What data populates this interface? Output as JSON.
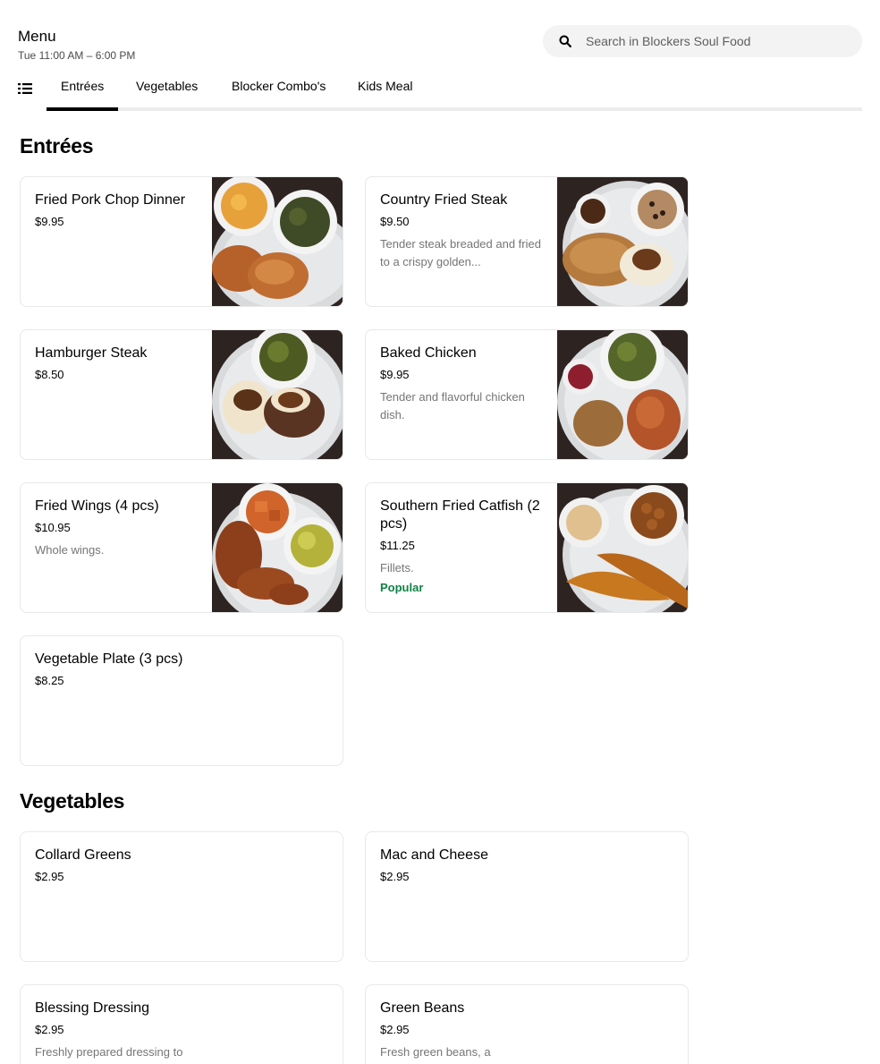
{
  "header": {
    "title": "Menu",
    "hours": "Tue 11:00 AM – 6:00 PM"
  },
  "search": {
    "placeholder": "Search in Blockers Soul Food",
    "icon": "search-icon"
  },
  "tabs": [
    {
      "label": "Entrées",
      "active": true
    },
    {
      "label": "Vegetables",
      "active": false
    },
    {
      "label": "Blocker Combo's",
      "active": false
    },
    {
      "label": "Kids Meal",
      "active": false
    }
  ],
  "sections": {
    "entrees": {
      "title": "Entrées",
      "items": [
        {
          "name": "Fried Pork Chop Dinner",
          "price": "$9.95",
          "description": "",
          "image": "fried pork chop dinner photo"
        },
        {
          "name": "Country Fried Steak",
          "price": "$9.50",
          "description": "Tender steak breaded and fried to a crispy golden...",
          "image": "country fried steak photo"
        },
        {
          "name": "Hamburger Steak",
          "price": "$8.50",
          "description": "",
          "image": "hamburger steak photo"
        },
        {
          "name": "Baked Chicken",
          "price": "$9.95",
          "description": "Tender and flavorful chicken dish.",
          "image": "baked chicken photo"
        },
        {
          "name": "Fried Wings (4 pcs)",
          "price": "$10.95",
          "description": "Whole wings.",
          "image": "fried wings photo"
        },
        {
          "name": "Southern Fried Catfish (2 pcs)",
          "price": "$11.25",
          "description": "Fillets.",
          "badge": "Popular",
          "image": "fried catfish photo"
        },
        {
          "name": "Vegetable Plate (3 pcs)",
          "price": "$8.25",
          "description": ""
        }
      ]
    },
    "vegetables": {
      "title": "Vegetables",
      "items": [
        {
          "name": "Collard Greens",
          "price": "$2.95",
          "description": ""
        },
        {
          "name": "Mac and Cheese",
          "price": "$2.95",
          "description": ""
        },
        {
          "name": "Blessing Dressing",
          "price": "$2.95",
          "description": "Freshly prepared dressing to"
        },
        {
          "name": "Green Beans",
          "price": "$2.95",
          "description": "Fresh green beans, a"
        }
      ]
    }
  },
  "colors": {
    "badge": "#0e8345",
    "plate": "#d6d9dc",
    "background_photo": "#2b2423"
  }
}
